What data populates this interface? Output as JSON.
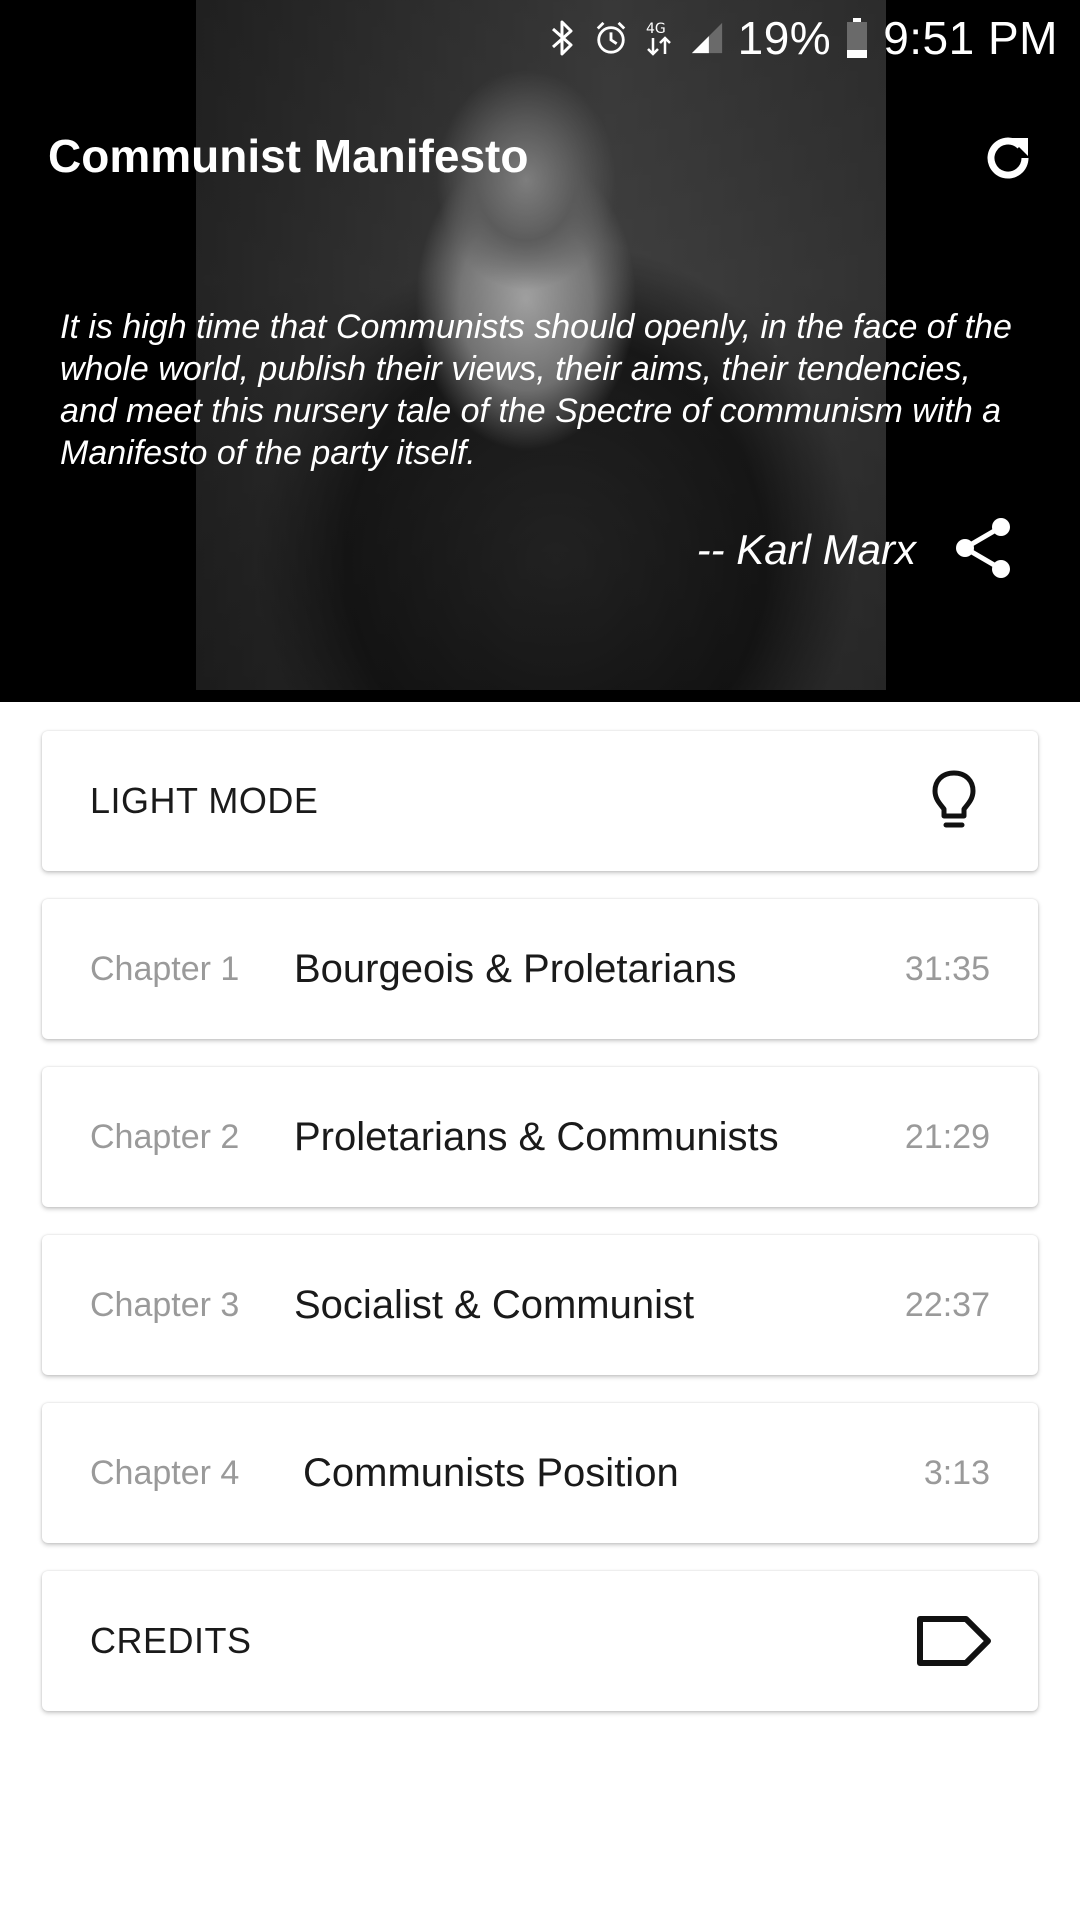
{
  "status_bar": {
    "battery": "19%",
    "time": "9:51 PM",
    "icons": [
      "bluetooth-icon",
      "alarm-icon",
      "4g-data-icon",
      "signal-icon",
      "battery-icon"
    ]
  },
  "header": {
    "title": "Communist Manifesto",
    "quote": "It is high time that Communists should openly, in the face of the whole world, publish their views, their aims, their tendencies, and meet this nursery tale of the Spectre of communism with a Manifesto of the party itself.",
    "author": "-- Karl Marx",
    "refresh_icon": "refresh-icon",
    "share_icon": "share-icon"
  },
  "light_mode": {
    "label": "LIGHT MODE",
    "icon": "lightbulb-icon"
  },
  "chapters": [
    {
      "number": "Chapter 1",
      "title": "Bourgeois & Proletarians",
      "duration": "31:35"
    },
    {
      "number": "Chapter 2",
      "title": "Proletarians & Communists",
      "duration": "21:29"
    },
    {
      "number": "Chapter 3",
      "title": "Socialist & Communist",
      "duration": "22:37"
    },
    {
      "number": "Chapter 4",
      "title": "Communists Position",
      "duration": "3:13"
    }
  ],
  "credits": {
    "label": "CREDITS",
    "icon": "label-tag-icon"
  },
  "colors": {
    "header_bg": "#000000",
    "card_bg": "#ffffff",
    "primary_text": "#1a1a1a",
    "secondary_text": "#9a9a9a"
  }
}
